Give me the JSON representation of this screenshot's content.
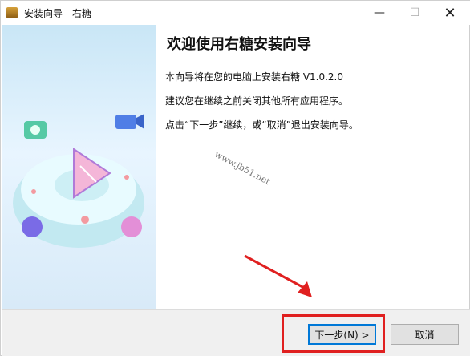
{
  "window": {
    "title": "安装向导 - 右糖",
    "minimize": "—",
    "maximize": "☐",
    "close": "✕"
  },
  "content": {
    "heading": "欢迎使用右糖安装向导",
    "line1": "本向导将在您的电脑上安装右糖 V1.0.2.0",
    "line2": "建议您在继续之前关闭其他所有应用程序。",
    "line3": "点击“下一步”继续，或“取消”退出安装向导。"
  },
  "watermark": "www.jb51.net",
  "buttons": {
    "next": "下一步(N) >",
    "cancel": "取消"
  },
  "colors": {
    "highlight": "#e02020",
    "focus": "#0078d7"
  }
}
